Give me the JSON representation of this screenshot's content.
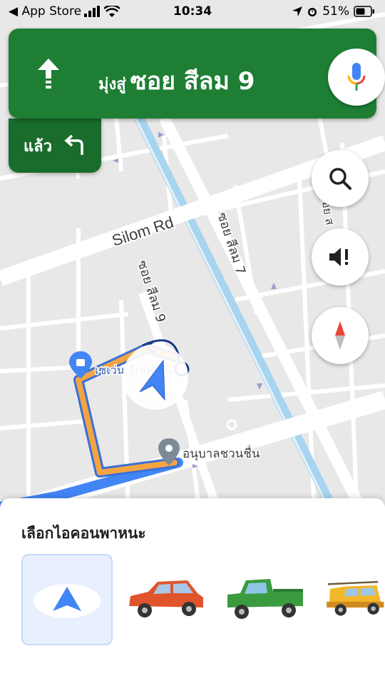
{
  "status_bar": {
    "back_app": "◀ App Store",
    "time": "10:34",
    "battery": "51%"
  },
  "navigation": {
    "prefix": "มุ่งสู่",
    "street": "ซอย สีลม 9",
    "then_label": "แล้ว"
  },
  "map": {
    "labels": {
      "silom_rd": "Silom Rd",
      "soi_silom_9": "ซอย สีลม 9",
      "soi_silom_7": "ซอย สีลม 7",
      "soi_right": "ซอย ส",
      "seven_eleven": "เซเว่น อีเลฟเว่น",
      "kindergarten": "อนุบาลชวนชื่น"
    }
  },
  "buttons": {
    "search": "search-icon",
    "sound": "sound-alert-icon",
    "compass": "compass-icon",
    "mic": "mic-icon"
  },
  "sheet": {
    "title": "เลือกไอคอนพาหนะ",
    "vehicles": [
      "navigation-arrow",
      "red-sedan",
      "green-pickup",
      "yellow-suv"
    ],
    "selected_index": 0
  },
  "colors": {
    "nav_green": "#1e7e34",
    "route_blue": "#4285f4",
    "route_orange": "#f4a442",
    "selected_tile": "#e8f0fe"
  }
}
